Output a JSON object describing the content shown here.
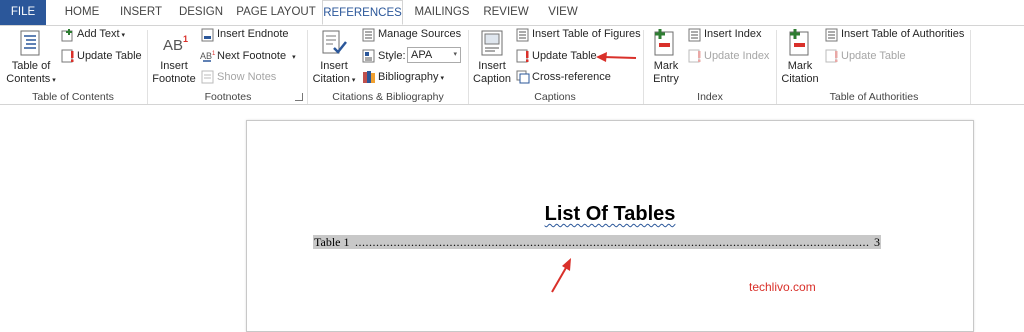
{
  "tabs": [
    {
      "label": "FILE"
    },
    {
      "label": "HOME"
    },
    {
      "label": "INSERT"
    },
    {
      "label": "DESIGN"
    },
    {
      "label": "PAGE LAYOUT"
    },
    {
      "label": "REFERENCES"
    },
    {
      "label": "MAILINGS"
    },
    {
      "label": "REVIEW"
    },
    {
      "label": "VIEW"
    }
  ],
  "active_tab": "REFERENCES",
  "ribbon": {
    "toc": {
      "table_of_contents_line1": "Table of",
      "table_of_contents_line2": "Contents",
      "add_text": "Add Text",
      "update_table": "Update Table",
      "group_label": "Table of Contents"
    },
    "footnotes": {
      "insert_footnote_line1": "Insert",
      "insert_footnote_line2": "Footnote",
      "insert_endnote": "Insert Endnote",
      "next_footnote": "Next Footnote",
      "show_notes": "Show Notes",
      "group_label": "Footnotes"
    },
    "citations": {
      "insert_citation_line1": "Insert",
      "insert_citation_line2": "Citation",
      "manage_sources": "Manage Sources",
      "style_label": "Style:",
      "style_value": "APA",
      "bibliography": "Bibliography",
      "group_label": "Citations & Bibliography"
    },
    "captions": {
      "insert_caption_line1": "Insert",
      "insert_caption_line2": "Caption",
      "insert_table_of_figures": "Insert Table of Figures",
      "update_table": "Update Table",
      "cross_reference": "Cross-reference",
      "group_label": "Captions"
    },
    "index": {
      "mark_entry_line1": "Mark",
      "mark_entry_line2": "Entry",
      "insert_index": "Insert Index",
      "update_index": "Update Index",
      "group_label": "Index"
    },
    "authorities": {
      "mark_citation_line1": "Mark",
      "mark_citation_line2": "Citation",
      "insert_table_of_authorities": "Insert Table of Authorities",
      "update_table": "Update Table",
      "group_label": "Table of Authorities"
    }
  },
  "document": {
    "title": "List Of Tables",
    "entries": [
      {
        "label": "Table 1",
        "page": "3"
      }
    ]
  },
  "watermark": "techlivo.com",
  "colors": {
    "accent": "#2b579a",
    "annotation_arrow": "#d9302a"
  }
}
